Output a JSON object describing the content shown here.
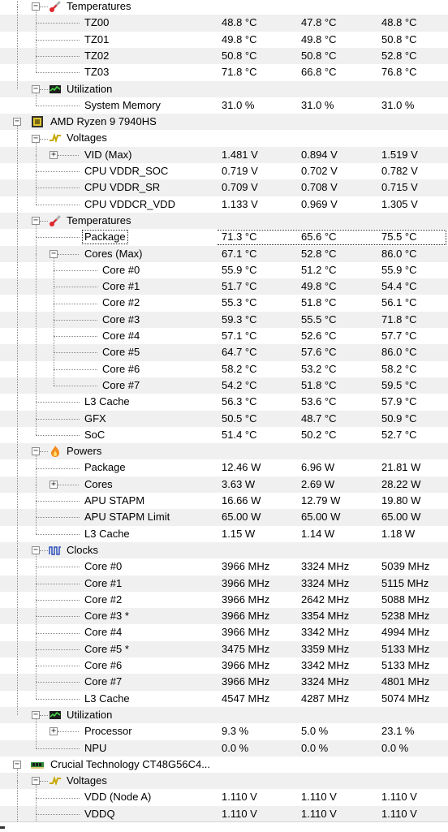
{
  "tree": [
    {
      "label": "Temperatures",
      "level": 1,
      "kind": "group",
      "icon": "thermometer-icon",
      "toggle": "minus"
    },
    {
      "label": "TZ00",
      "level": 2,
      "values": [
        "48.8 °C",
        "47.8 °C",
        "48.8 °C"
      ]
    },
    {
      "label": "TZ01",
      "level": 2,
      "values": [
        "49.8 °C",
        "49.8 °C",
        "50.8 °C"
      ]
    },
    {
      "label": "TZ02",
      "level": 2,
      "values": [
        "50.8 °C",
        "50.8 °C",
        "52.8 °C"
      ]
    },
    {
      "label": "TZ03",
      "level": 2,
      "values": [
        "71.8 °C",
        "66.8 °C",
        "76.8 °C"
      ]
    },
    {
      "label": "Utilization",
      "level": 1,
      "kind": "group",
      "icon": "utilization-monitor-icon",
      "toggle": "minus"
    },
    {
      "label": "System Memory",
      "level": 2,
      "values": [
        "31.0 %",
        "31.0 %",
        "31.0 %"
      ]
    },
    {
      "label": "AMD Ryzen 9 7940HS",
      "level": 0,
      "kind": "device",
      "icon": "cpu-chip-icon",
      "toggle": "minus"
    },
    {
      "label": "Voltages",
      "level": 1,
      "kind": "group",
      "icon": "voltage-icon",
      "toggle": "minus"
    },
    {
      "label": "VID (Max)",
      "level": 2,
      "values": [
        "1.481 V",
        "0.894 V",
        "1.519 V"
      ],
      "toggle": "plus"
    },
    {
      "label": "CPU VDDR_SOC",
      "level": 2,
      "values": [
        "0.719 V",
        "0.702 V",
        "0.782 V"
      ]
    },
    {
      "label": "CPU VDDR_SR",
      "level": 2,
      "values": [
        "0.709 V",
        "0.708 V",
        "0.715 V"
      ]
    },
    {
      "label": "CPU VDDCR_VDD",
      "level": 2,
      "values": [
        "1.133 V",
        "0.969 V",
        "1.305 V"
      ]
    },
    {
      "label": "Temperatures",
      "level": 1,
      "kind": "group",
      "icon": "thermometer-icon",
      "toggle": "minus"
    },
    {
      "label": "Package",
      "level": 2,
      "values": [
        "71.3 °C",
        "65.6 °C",
        "75.5 °C"
      ],
      "selected": true
    },
    {
      "label": "Cores (Max)",
      "level": 2,
      "values": [
        "67.1 °C",
        "52.8 °C",
        "86.0 °C"
      ],
      "toggle": "minus"
    },
    {
      "label": "Core #0",
      "level": 3,
      "values": [
        "55.9 °C",
        "51.2 °C",
        "55.9 °C"
      ]
    },
    {
      "label": "Core #1",
      "level": 3,
      "values": [
        "51.7 °C",
        "49.8 °C",
        "54.4 °C"
      ]
    },
    {
      "label": "Core #2",
      "level": 3,
      "values": [
        "55.3 °C",
        "51.8 °C",
        "56.1 °C"
      ]
    },
    {
      "label": "Core #3",
      "level": 3,
      "values": [
        "59.3 °C",
        "55.5 °C",
        "71.8 °C"
      ]
    },
    {
      "label": "Core #4",
      "level": 3,
      "values": [
        "57.1 °C",
        "52.6 °C",
        "57.7 °C"
      ]
    },
    {
      "label": "Core #5",
      "level": 3,
      "values": [
        "64.7 °C",
        "57.6 °C",
        "86.0 °C"
      ]
    },
    {
      "label": "Core #6",
      "level": 3,
      "values": [
        "58.2 °C",
        "53.2 °C",
        "58.2 °C"
      ]
    },
    {
      "label": "Core #7",
      "level": 3,
      "values": [
        "54.2 °C",
        "51.8 °C",
        "59.5 °C"
      ]
    },
    {
      "label": "L3 Cache",
      "level": 2,
      "values": [
        "56.3 °C",
        "53.6 °C",
        "57.9 °C"
      ]
    },
    {
      "label": "GFX",
      "level": 2,
      "values": [
        "50.5 °C",
        "48.7 °C",
        "50.9 °C"
      ]
    },
    {
      "label": "SoC",
      "level": 2,
      "values": [
        "51.4 °C",
        "50.2 °C",
        "52.7 °C"
      ]
    },
    {
      "label": "Powers",
      "level": 1,
      "kind": "group",
      "icon": "flame-icon",
      "toggle": "minus"
    },
    {
      "label": "Package",
      "level": 2,
      "values": [
        "12.46 W",
        "6.96 W",
        "21.81 W"
      ]
    },
    {
      "label": "Cores",
      "level": 2,
      "values": [
        "3.63 W",
        "2.69 W",
        "28.22 W"
      ],
      "toggle": "plus"
    },
    {
      "label": "APU STAPM",
      "level": 2,
      "values": [
        "16.66 W",
        "12.79 W",
        "19.80 W"
      ]
    },
    {
      "label": "APU STAPM Limit",
      "level": 2,
      "values": [
        "65.00 W",
        "65.00 W",
        "65.00 W"
      ]
    },
    {
      "label": "L3 Cache",
      "level": 2,
      "values": [
        "1.15 W",
        "1.14 W",
        "1.18 W"
      ]
    },
    {
      "label": "Clocks",
      "level": 1,
      "kind": "group",
      "icon": "clock-signal-icon",
      "toggle": "minus"
    },
    {
      "label": "Core #0",
      "level": 2,
      "values": [
        "3966 MHz",
        "3324 MHz",
        "5039 MHz"
      ]
    },
    {
      "label": "Core #1",
      "level": 2,
      "values": [
        "3966 MHz",
        "3324 MHz",
        "5115 MHz"
      ]
    },
    {
      "label": "Core #2",
      "level": 2,
      "values": [
        "3966 MHz",
        "2642 MHz",
        "5088 MHz"
      ]
    },
    {
      "label": "Core #3 *",
      "level": 2,
      "values": [
        "3966 MHz",
        "3354 MHz",
        "5238 MHz"
      ]
    },
    {
      "label": "Core #4",
      "level": 2,
      "values": [
        "3966 MHz",
        "3342 MHz",
        "4994 MHz"
      ]
    },
    {
      "label": "Core #5 *",
      "level": 2,
      "values": [
        "3475 MHz",
        "3359 MHz",
        "5133 MHz"
      ]
    },
    {
      "label": "Core #6",
      "level": 2,
      "values": [
        "3966 MHz",
        "3342 MHz",
        "5133 MHz"
      ]
    },
    {
      "label": "Core #7",
      "level": 2,
      "values": [
        "3966 MHz",
        "3324 MHz",
        "4801 MHz"
      ]
    },
    {
      "label": "L3 Cache",
      "level": 2,
      "values": [
        "4547 MHz",
        "4287 MHz",
        "5074 MHz"
      ]
    },
    {
      "label": "Utilization",
      "level": 1,
      "kind": "group",
      "icon": "utilization-monitor-icon",
      "toggle": "minus"
    },
    {
      "label": "Processor",
      "level": 2,
      "values": [
        "9.3 %",
        "5.0 %",
        "23.1 %"
      ],
      "toggle": "plus"
    },
    {
      "label": "NPU",
      "level": 2,
      "values": [
        "0.0 %",
        "0.0 %",
        "0.0 %"
      ]
    },
    {
      "label": "Crucial Technology CT48G56C4...",
      "level": 0,
      "kind": "device",
      "icon": "memory-module-icon",
      "toggle": "minus"
    },
    {
      "label": "Voltages",
      "level": 1,
      "kind": "group",
      "icon": "voltage-icon",
      "toggle": "minus"
    },
    {
      "label": "VDD (Node A)",
      "level": 2,
      "values": [
        "1.110 V",
        "1.110 V",
        "1.110 V"
      ]
    },
    {
      "label": "VDDQ",
      "level": 2,
      "values": [
        "1.110 V",
        "1.110 V",
        "1.110 V"
      ]
    }
  ]
}
